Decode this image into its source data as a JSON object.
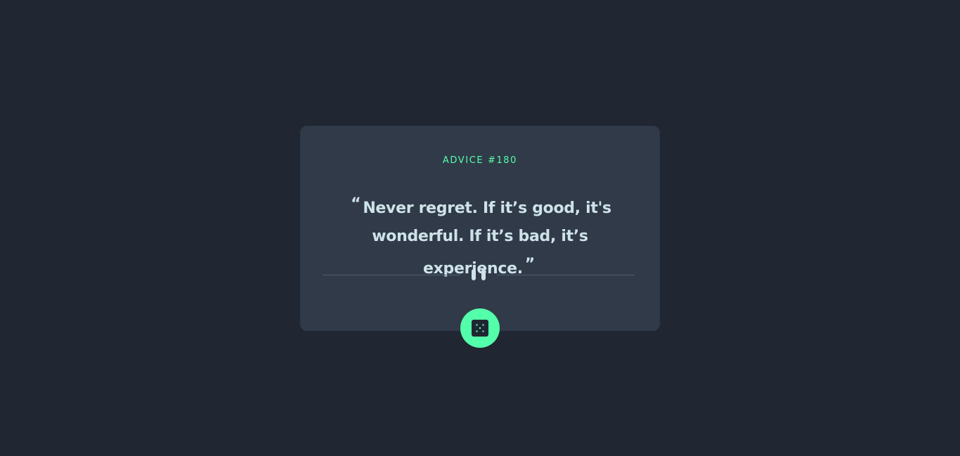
{
  "advice": {
    "id_label": "ADVICE #180",
    "open_quote": "“",
    "text": "Never regret. If it’s good, it's wonderful. If it’s bad, it’s experience.",
    "close_quote": "”"
  },
  "icons": {
    "divider": "pause-icon",
    "button": "dice-icon"
  },
  "colors": {
    "background": "#202632",
    "card": "#313a48",
    "accent": "#53ffaa",
    "text": "#cee3e9",
    "divider": "#4f5d74"
  }
}
